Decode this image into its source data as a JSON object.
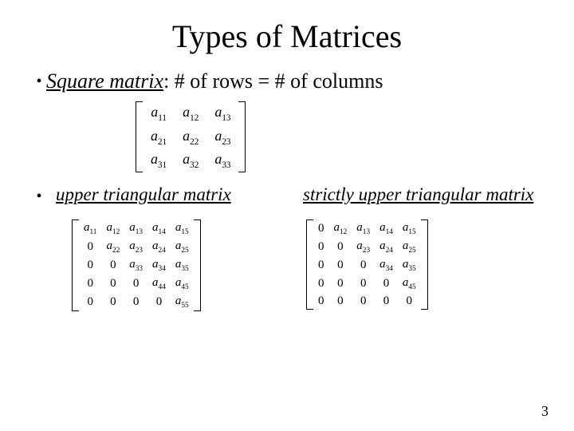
{
  "title": "Types of Matrices",
  "bullet1": {
    "term": "Square matrix",
    "rest": ": # of rows = # of columns"
  },
  "matrix3": {
    "rows": [
      [
        {
          "a": "a",
          "sub": "11"
        },
        {
          "a": "a",
          "sub": "12"
        },
        {
          "a": "a",
          "sub": "13"
        }
      ],
      [
        {
          "a": "a",
          "sub": "21"
        },
        {
          "a": "a",
          "sub": "22"
        },
        {
          "a": "a",
          "sub": "23"
        }
      ],
      [
        {
          "a": "a",
          "sub": "31"
        },
        {
          "a": "a",
          "sub": "32"
        },
        {
          "a": "a",
          "sub": "33"
        }
      ]
    ]
  },
  "upper": {
    "label": "upper triangular matrix",
    "rows": [
      [
        {
          "a": "a",
          "sub": "11"
        },
        {
          "a": "a",
          "sub": "12"
        },
        {
          "a": "a",
          "sub": "13"
        },
        {
          "a": "a",
          "sub": "14"
        },
        {
          "a": "a",
          "sub": "15"
        }
      ],
      [
        {
          "z": "0"
        },
        {
          "a": "a",
          "sub": "22"
        },
        {
          "a": "a",
          "sub": "23"
        },
        {
          "a": "a",
          "sub": "24"
        },
        {
          "a": "a",
          "sub": "25"
        }
      ],
      [
        {
          "z": "0"
        },
        {
          "z": "0"
        },
        {
          "a": "a",
          "sub": "33"
        },
        {
          "a": "a",
          "sub": "34"
        },
        {
          "a": "a",
          "sub": "35"
        }
      ],
      [
        {
          "z": "0"
        },
        {
          "z": "0"
        },
        {
          "z": "0"
        },
        {
          "a": "a",
          "sub": "44"
        },
        {
          "a": "a",
          "sub": "45"
        }
      ],
      [
        {
          "z": "0"
        },
        {
          "z": "0"
        },
        {
          "z": "0"
        },
        {
          "z": "0"
        },
        {
          "a": "a",
          "sub": "55"
        }
      ]
    ]
  },
  "strict": {
    "label": "strictly upper triangular matrix",
    "rows": [
      [
        {
          "z": "0"
        },
        {
          "a": "a",
          "sub": "12"
        },
        {
          "a": "a",
          "sub": "13"
        },
        {
          "a": "a",
          "sub": "14"
        },
        {
          "a": "a",
          "sub": "15"
        }
      ],
      [
        {
          "z": "0"
        },
        {
          "z": "0"
        },
        {
          "a": "a",
          "sub": "23"
        },
        {
          "a": "a",
          "sub": "24"
        },
        {
          "a": "a",
          "sub": "25"
        }
      ],
      [
        {
          "z": "0"
        },
        {
          "z": "0"
        },
        {
          "z": "0"
        },
        {
          "a": "a",
          "sub": "34"
        },
        {
          "a": "a",
          "sub": "35"
        }
      ],
      [
        {
          "z": "0"
        },
        {
          "z": "0"
        },
        {
          "z": "0"
        },
        {
          "z": "0"
        },
        {
          "a": "a",
          "sub": "45"
        }
      ],
      [
        {
          "z": "0"
        },
        {
          "z": "0"
        },
        {
          "z": "0"
        },
        {
          "z": "0"
        },
        {
          "z": "0"
        }
      ]
    ]
  },
  "page_number": "3"
}
